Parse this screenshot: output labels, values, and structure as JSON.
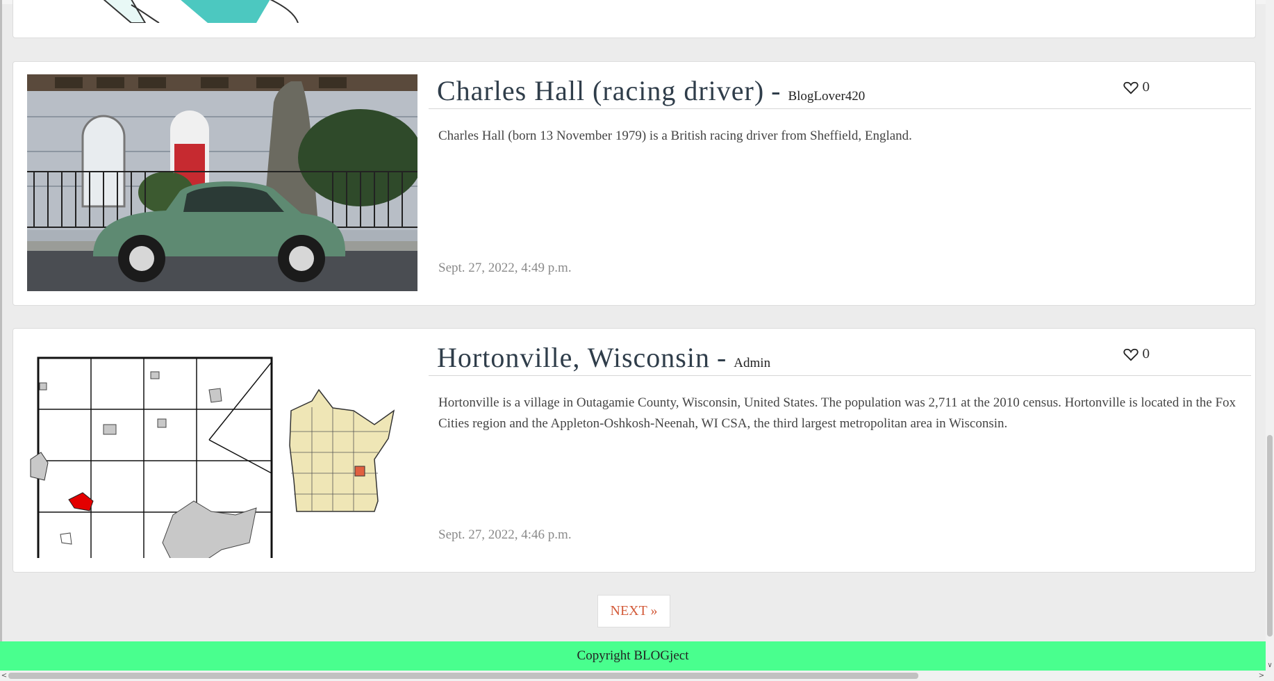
{
  "posts": [
    {
      "title": "Charles Hall (racing driver)",
      "separator": "-",
      "author": "BlogLover420",
      "likes": "0",
      "excerpt": "Charles Hall (born 13 November 1979) is a British racing driver from Sheffield, England.",
      "date": "Sept. 27, 2022, 4:49 p.m.",
      "image_icon": "car-photo"
    },
    {
      "title": "Hortonville, Wisconsin",
      "separator": "-",
      "author": "Admin",
      "likes": "0",
      "excerpt": "Hortonville is a village in Outagamie County, Wisconsin, United States. The population was 2,711 at the 2010 census. Hortonville is located in the Fox Cities region and the Appleton-Oshkosh-Neenah, WI CSA, the third largest metropolitan area in Wisconsin.",
      "date": "Sept. 27, 2022, 4:46 p.m.",
      "image_icon": "map-image"
    }
  ],
  "pagination": {
    "next_label": "NEXT »"
  },
  "footer": {
    "text": "Copyright BLOGject"
  },
  "colors": {
    "footer_bg": "#49ff8e",
    "next_text": "#d35b3a",
    "title_text": "#2f3d4a"
  }
}
